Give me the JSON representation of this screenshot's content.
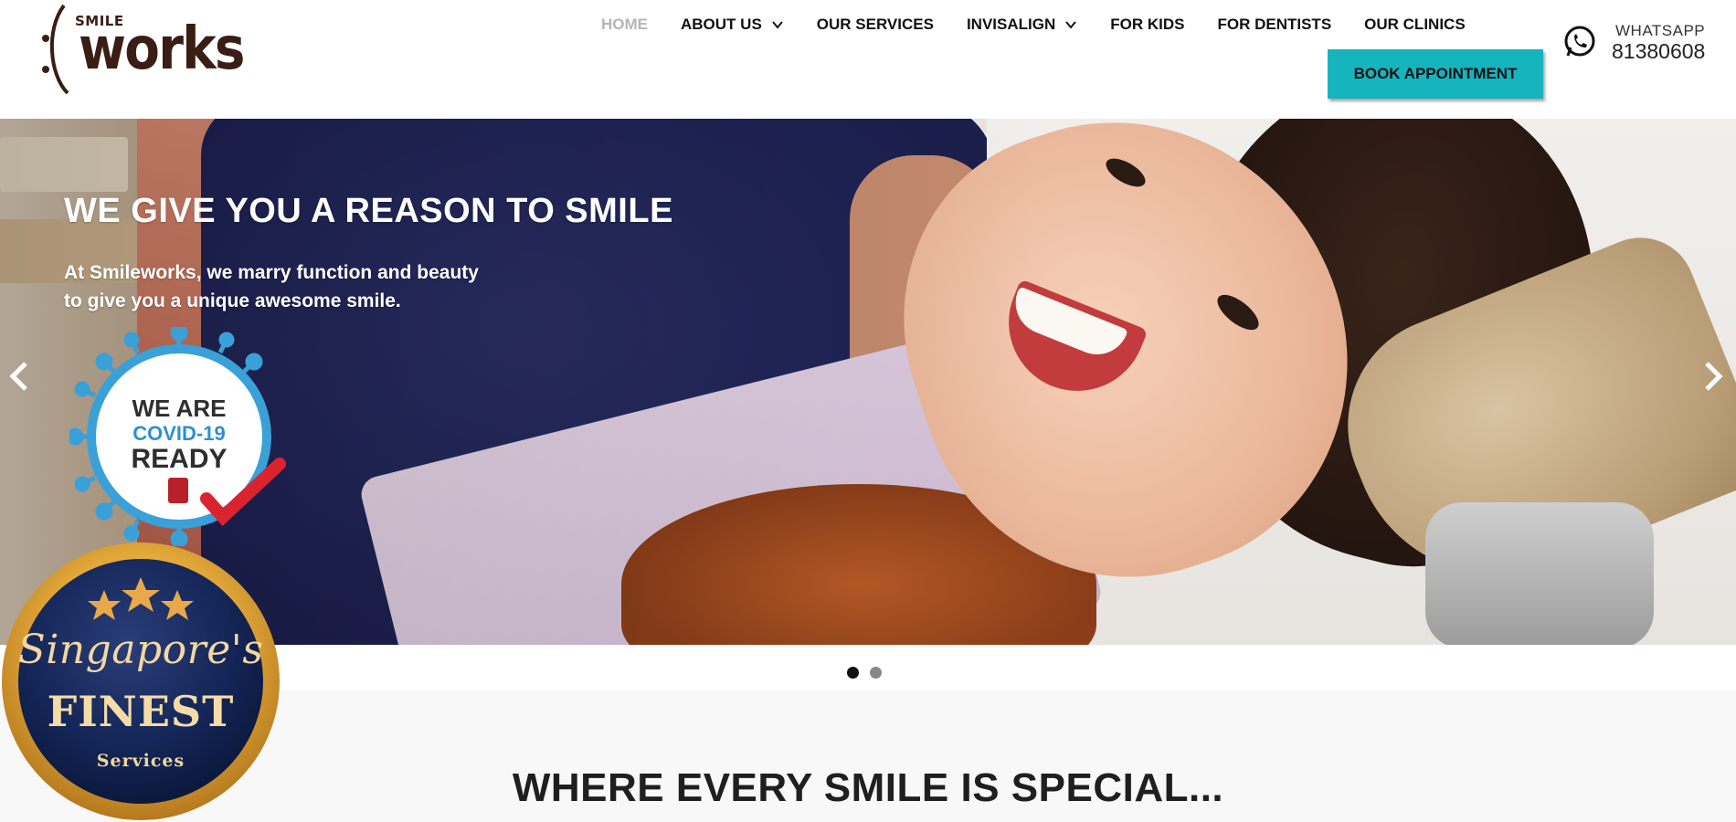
{
  "logo": {
    "small_text": "SMILE",
    "main_text": "works"
  },
  "nav": {
    "items": [
      {
        "label": "HOME",
        "active": true,
        "has_dropdown": false
      },
      {
        "label": "ABOUT US",
        "active": false,
        "has_dropdown": true
      },
      {
        "label": "OUR SERVICES",
        "active": false,
        "has_dropdown": false
      },
      {
        "label": "INVISALIGN",
        "active": false,
        "has_dropdown": true
      },
      {
        "label": "FOR KIDS",
        "active": false,
        "has_dropdown": false
      },
      {
        "label": "FOR DENTISTS",
        "active": false,
        "has_dropdown": false
      },
      {
        "label": "OUR CLINICS",
        "active": false,
        "has_dropdown": false
      }
    ],
    "book_button": "BOOK APPOINTMENT"
  },
  "whatsapp": {
    "label": "WHATSAPP",
    "number": "81380608",
    "icon": "whatsapp-icon"
  },
  "hero": {
    "title": "WE GIVE YOU A REASON TO SMILE",
    "subtitle_line1": "At Smileworks, we marry function and beauty",
    "subtitle_line2": "to give you a unique awesome smile.",
    "covid_badge": {
      "line1": "WE ARE",
      "line2": "COVID-19",
      "line3": "READY"
    },
    "prev_icon": "chevron-left-icon",
    "next_icon": "chevron-right-icon",
    "slide_count": 2,
    "active_slide": 1
  },
  "section": {
    "title": "WHERE EVERY SMILE IS SPECIAL..."
  },
  "award_badge": {
    "script": "Singapore's",
    "main": "FINEST",
    "sub": "Services",
    "stars": 3
  },
  "colors": {
    "accent": "#16b4bd",
    "logo_brown": "#3a1d14",
    "badge_navy": "#0f1f4a",
    "badge_gold": "#e2a83a"
  }
}
